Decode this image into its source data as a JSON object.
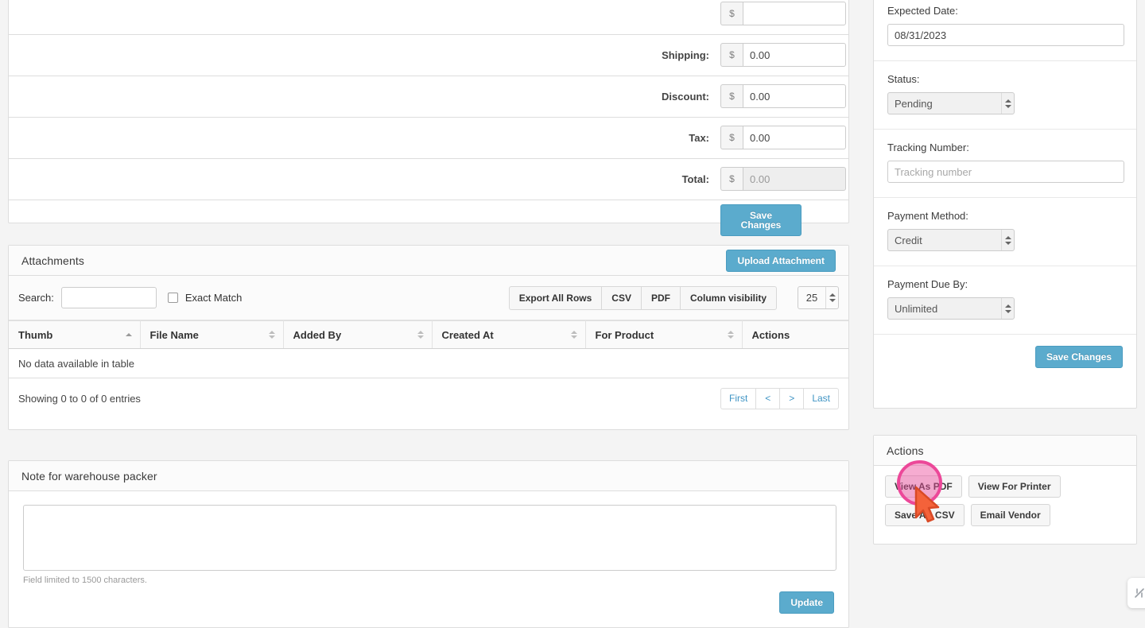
{
  "theme": {
    "accent_blue": "#5babcd",
    "page_bg": "#f4f4f4",
    "panel_bg": "#ffffff",
    "border": "#dddddd",
    "link_blue": "#3f94c4",
    "cursor_highlight": "#ec4899",
    "cursor_arrow": "#f4623a"
  },
  "totals": {
    "rows": [
      {
        "label": "Shipping:",
        "currency": "$",
        "value": "0.00",
        "disabled": false
      },
      {
        "label": "Discount:",
        "currency": "$",
        "value": "0.00",
        "disabled": false
      },
      {
        "label": "Tax:",
        "currency": "$",
        "value": "0.00",
        "disabled": false
      },
      {
        "label": "Total:",
        "currency": "$",
        "value": "0.00",
        "disabled": true
      }
    ],
    "save_label": "Save Changes"
  },
  "attachments": {
    "title": "Attachments",
    "upload_label": "Upload Attachment",
    "search_label": "Search:",
    "search_value": "",
    "exact_match_label": "Exact Match",
    "exact_match_checked": false,
    "export_buttons": [
      "Export All Rows",
      "CSV",
      "PDF",
      "Column visibility"
    ],
    "page_length": "25",
    "columns": [
      {
        "label": "Thumb",
        "sort": "asc"
      },
      {
        "label": "File Name",
        "sort": "none"
      },
      {
        "label": "Added By",
        "sort": "none"
      },
      {
        "label": "Created At",
        "sort": "none"
      },
      {
        "label": "For Product",
        "sort": "none"
      },
      {
        "label": "Actions",
        "sort": "off"
      }
    ],
    "empty_message": "No data available in table",
    "info": "Showing 0 to 0 of 0 entries",
    "pager": [
      "First",
      "<",
      ">",
      "Last"
    ]
  },
  "note": {
    "title": "Note for warehouse packer",
    "value": "",
    "help": "Field limited to 1500 characters.",
    "update_label": "Update"
  },
  "details": {
    "expected_date": {
      "label": "Expected Date:",
      "value": "08/31/2023"
    },
    "status": {
      "label": "Status:",
      "value": "Pending"
    },
    "tracking": {
      "label": "Tracking Number:",
      "value": "",
      "placeholder": "Tracking number"
    },
    "payment_method": {
      "label": "Payment Method:",
      "value": "Credit"
    },
    "payment_due": {
      "label": "Payment Due By:",
      "value": "Unlimited"
    },
    "save_label": "Save Changes"
  },
  "actions": {
    "title": "Actions",
    "buttons": [
      {
        "label": "View As PDF"
      },
      {
        "label": "View For Printer"
      },
      {
        "label": "Save AS CSV"
      },
      {
        "label": "Email Vendor"
      }
    ]
  }
}
